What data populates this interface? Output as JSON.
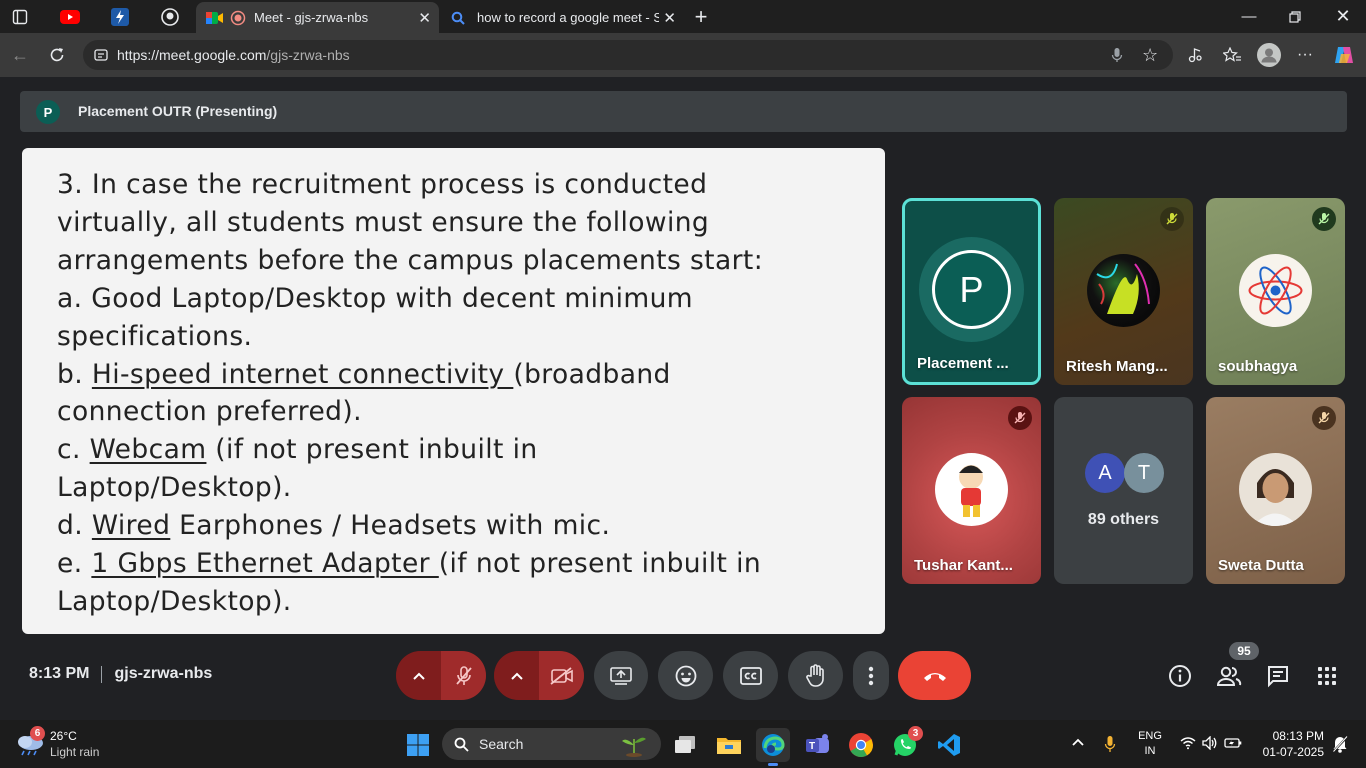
{
  "browser": {
    "tabs": [
      {
        "title": "Meet - gjs-zrwa-nbs",
        "active": true
      },
      {
        "title": "how to record a google meet - Se",
        "active": false
      }
    ],
    "url_host": "https://meet.google.com",
    "url_path": "/gjs-zrwa-nbs"
  },
  "meet": {
    "presenter_initial": "P",
    "presenter_label": "Placement OUTR (Presenting)",
    "slide": {
      "line1": "3. In case the recruitment process is conducted",
      "line2": "virtually, all students must ensure the following",
      "line3": "arrangements before the campus placements start:",
      "line4": "a. Good Laptop/Desktop with decent minimum",
      "line5": "specifications.",
      "line6_prefix": "b. ",
      "line6_link": "Hi-speed internet connectivity ",
      "line6_suffix": "(broadband",
      "line7": "connection preferred).",
      "line8_prefix": "c. ",
      "line8_link": "Webcam",
      "line8_suffix": " (if not present inbuilt in",
      "line9": "Laptop/Desktop).",
      "line10_prefix": "d. ",
      "line10_link": "Wired",
      "line10_suffix": " Earphones / Headsets with mic.",
      "line11_prefix": "e. ",
      "line11_link": "1 Gbps Ethernet Adapter ",
      "line11_suffix": "(if not present inbuilt in",
      "line12": "Laptop/Desktop)."
    },
    "participants": [
      {
        "name": "Placement ...",
        "initial": "P"
      },
      {
        "name": "Ritesh Mang..."
      },
      {
        "name": "soubhagya"
      },
      {
        "name": "Tushar Kant..."
      },
      {
        "name": "89 others",
        "initials": [
          "A",
          "T"
        ]
      },
      {
        "name": "Sweta Dutta"
      }
    ],
    "time": "8:13 PM",
    "meeting_code": "gjs-zrwa-nbs",
    "people_count": "95"
  },
  "taskbar": {
    "weather_badge": "6",
    "temperature": "26°C",
    "weather_text": "Light rain",
    "search_label": "Search",
    "whatsapp_badge": "3",
    "lang1": "ENG",
    "lang2": "IN",
    "clock_time": "08:13 PM",
    "clock_date": "01-07-2025"
  },
  "colors": {
    "end_call": "#ea4335",
    "muted_red": "#7f1d1d",
    "presenter_teal": "#0b5e55"
  }
}
